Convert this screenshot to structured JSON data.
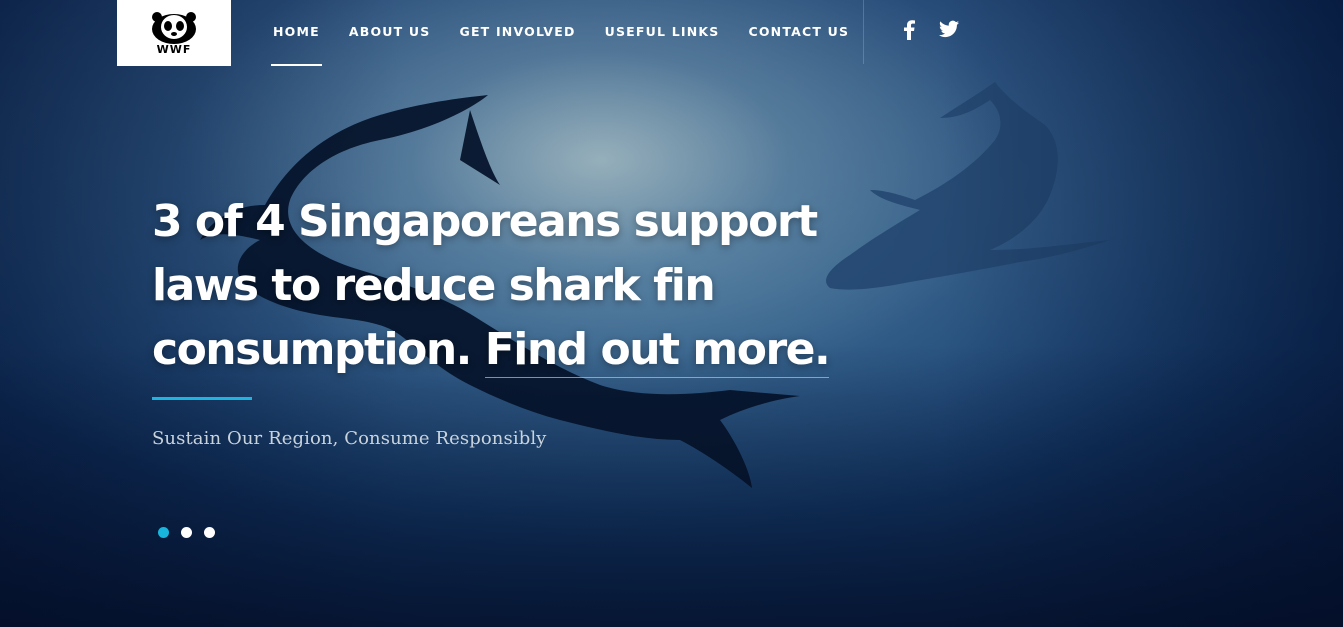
{
  "brand": {
    "logo_text": "WWF"
  },
  "nav": {
    "items": [
      {
        "label": "HOME",
        "active": true
      },
      {
        "label": "ABOUT US",
        "active": false
      },
      {
        "label": "GET INVOLVED",
        "active": false
      },
      {
        "label": "USEFUL LINKS",
        "active": false
      },
      {
        "label": "CONTACT US",
        "active": false
      }
    ]
  },
  "social": [
    "facebook-icon",
    "twitter-icon"
  ],
  "hero": {
    "headline_line1": "3 of 4 Singaporeans support",
    "headline_line2": "laws to reduce shark fin",
    "headline_line3_text": "consumption.",
    "headline_link": "Find out more.",
    "subtitle": "Sustain Our Region, Consume Responsibly"
  },
  "slider": {
    "count": 3,
    "active_index": 0
  },
  "colors": {
    "accent": "#1fb4e0",
    "active_dot": "#19b5dc",
    "background": "#153e70"
  }
}
